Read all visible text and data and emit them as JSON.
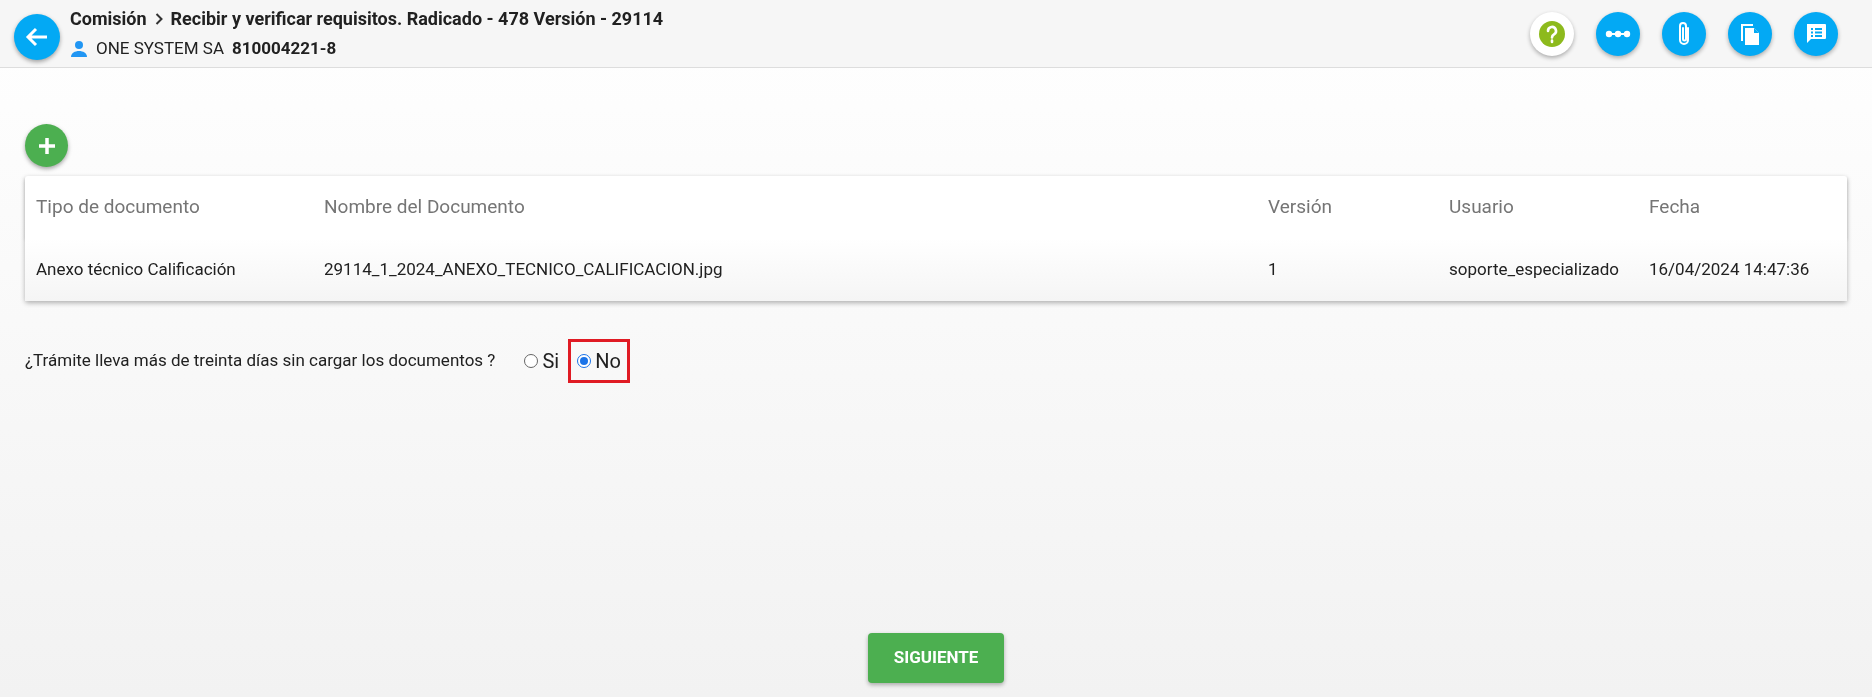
{
  "header": {
    "breadcrumb": [
      {
        "label": "Comisión"
      },
      {
        "label": "Recibir y verificar requisitos. Radicado - 478 Versión - 29114"
      }
    ],
    "company": "ONE SYSTEM SA",
    "nit": "810004221-8"
  },
  "toolbar": [
    {
      "kind": "help"
    },
    {
      "kind": "flow"
    },
    {
      "kind": "attach"
    },
    {
      "kind": "copy"
    },
    {
      "kind": "notes"
    }
  ],
  "table": {
    "columns": [
      "Tipo de documento",
      "Nombre del Documento",
      "Versión",
      "Usuario",
      "Fecha"
    ],
    "rows": [
      [
        "Anexo técnico Calificación",
        "29114_1_2024_ANEXO_TECNICO_CALIFICACION.jpg",
        "1",
        "soporte_especializado",
        "16/04/2024 14:47:36"
      ]
    ]
  },
  "question": {
    "text": "¿Trámite lleva más de treinta días sin cargar los documentos ?",
    "options": [
      {
        "label": "Si",
        "selected": false,
        "highlighted": false
      },
      {
        "label": "No",
        "selected": true,
        "highlighted": true
      }
    ]
  },
  "next_button": "SIGUIENTE"
}
